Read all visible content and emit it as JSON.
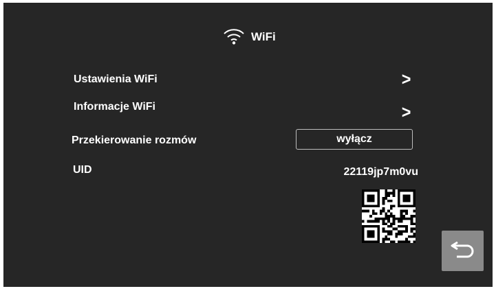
{
  "header": {
    "title": "WiFi",
    "icon": "wifi-icon"
  },
  "menu": {
    "wifi_settings": {
      "label": "Ustawienia WiFi",
      "chevron": ">"
    },
    "wifi_info": {
      "label": "Informacje WiFi",
      "chevron": ">"
    },
    "call_forwarding": {
      "label": "Przekierowanie rozmów",
      "value": "wyłącz"
    },
    "uid": {
      "label": "UID",
      "value": "22119jp7m0vu"
    }
  },
  "qr": {
    "icon": "qr-code"
  },
  "footer": {
    "back_icon": "return-arrow-icon"
  },
  "colors": {
    "background": "#262626",
    "text": "#ffffff",
    "back_button": "#8a8a8a"
  }
}
